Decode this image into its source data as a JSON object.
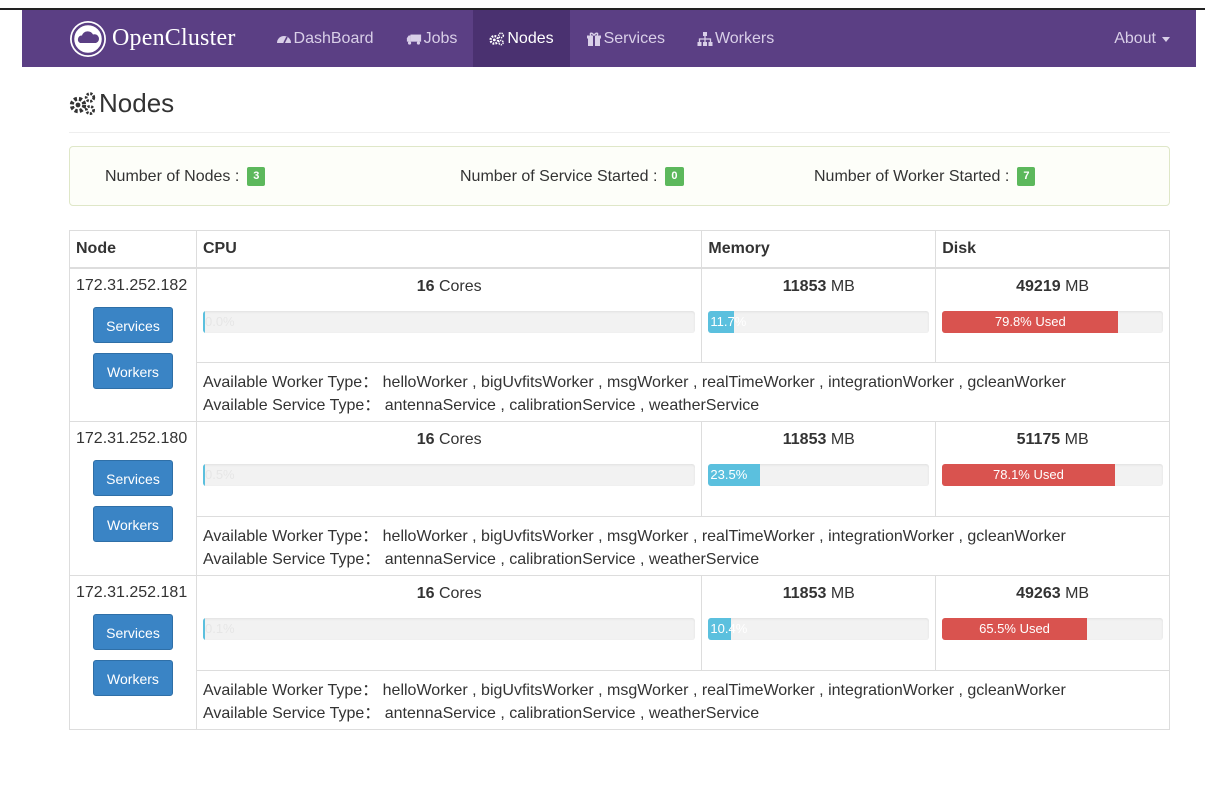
{
  "nav": {
    "brand": "OpenCluster",
    "items": [
      {
        "label": "DashBoard",
        "icon": "dashboard-icon"
      },
      {
        "label": "Jobs",
        "icon": "truck-icon"
      },
      {
        "label": "Nodes",
        "icon": "cogs-icon"
      },
      {
        "label": "Services",
        "icon": "gift-icon"
      },
      {
        "label": "Workers",
        "icon": "sitemap-icon"
      }
    ],
    "active": "Nodes",
    "about": "About"
  },
  "page": {
    "title": "Nodes"
  },
  "summary": {
    "nodes_label": "Number of Nodes :",
    "nodes_count": "3",
    "service_label": "Number of Service Started :",
    "service_count": "0",
    "worker_label": "Number of Worker Started :",
    "worker_count": "7"
  },
  "table": {
    "headers": {
      "node": "Node",
      "cpu": "CPU",
      "memory": "Memory",
      "disk": "Disk"
    },
    "buttons": {
      "services": "Services",
      "workers": "Workers"
    },
    "worker_type_label": "Available Worker Type：",
    "service_type_label": "Available Service Type：",
    "rows": [
      {
        "ip": "172.31.252.182",
        "cores": "16",
        "cores_unit": " Cores",
        "memory": "11853",
        "memory_unit": " MB",
        "disk": "49219",
        "disk_unit": " MB",
        "cpu_pct": 0.0,
        "cpu_text": "0.0%",
        "mem_pct": 11.7,
        "mem_text": "11.7%",
        "disk_pct": 79.8,
        "disk_text": "79.8% Used",
        "worker_types": "helloWorker , bigUvfitsWorker , msgWorker , realTimeWorker , integrationWorker , gcleanWorker",
        "service_types": "antennaService , calibrationService , weatherService"
      },
      {
        "ip": "172.31.252.180",
        "cores": "16",
        "cores_unit": " Cores",
        "memory": "11853",
        "memory_unit": " MB",
        "disk": "51175",
        "disk_unit": " MB",
        "cpu_pct": 0.5,
        "cpu_text": "0.5%",
        "mem_pct": 23.5,
        "mem_text": "23.5%",
        "disk_pct": 78.1,
        "disk_text": "78.1% Used",
        "worker_types": "helloWorker , bigUvfitsWorker , msgWorker , realTimeWorker , integrationWorker , gcleanWorker",
        "service_types": "antennaService , calibrationService , weatherService"
      },
      {
        "ip": "172.31.252.181",
        "cores": "16",
        "cores_unit": " Cores",
        "memory": "11853",
        "memory_unit": " MB",
        "disk": "49263",
        "disk_unit": " MB",
        "cpu_pct": 0.1,
        "cpu_text": "0.1%",
        "mem_pct": 10.4,
        "mem_text": "10.4%",
        "disk_pct": 65.5,
        "disk_text": "65.5% Used",
        "worker_types": "helloWorker , bigUvfitsWorker , msgWorker , realTimeWorker , integrationWorker , gcleanWorker",
        "service_types": "antennaService , calibrationService , weatherService"
      }
    ]
  },
  "colors": {
    "navbar": "#5b3f84",
    "navbar_active": "#4a3170",
    "button": "#3a84c5",
    "badge": "#5cb85c",
    "info_bar": "#5bc0de",
    "danger_bar": "#d9534f"
  }
}
